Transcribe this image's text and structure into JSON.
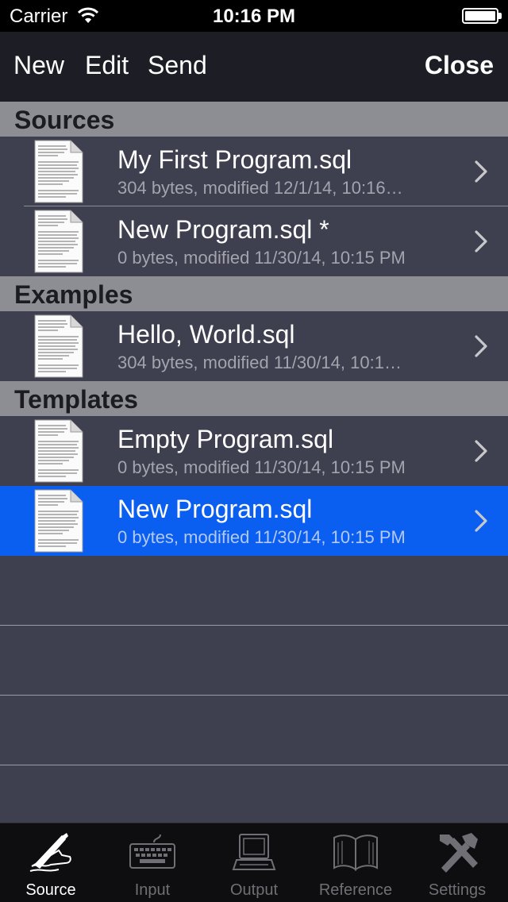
{
  "status_bar": {
    "carrier": "Carrier",
    "time": "10:16 PM"
  },
  "nav": {
    "new_label": "New",
    "edit_label": "Edit",
    "send_label": "Send",
    "close_label": "Close"
  },
  "sections": [
    {
      "header": "Sources",
      "rows": [
        {
          "title": "My First Program.sql",
          "subtitle": "304 bytes, modified 12/1/14, 10:16…"
        },
        {
          "title": "New Program.sql *",
          "subtitle": "0 bytes, modified 11/30/14, 10:15 PM"
        }
      ]
    },
    {
      "header": "Examples",
      "rows": [
        {
          "title": "Hello, World.sql",
          "subtitle": "304 bytes, modified 11/30/14, 10:1…"
        }
      ]
    },
    {
      "header": "Templates",
      "rows": [
        {
          "title": "Empty Program.sql",
          "subtitle": "0 bytes, modified 11/30/14, 10:15 PM"
        },
        {
          "title": "New Program.sql",
          "subtitle": "0 bytes, modified 11/30/14, 10:15 PM",
          "selected": true
        }
      ]
    }
  ],
  "tabs": [
    {
      "label": "Source",
      "icon": "pen-hand-icon",
      "active": true
    },
    {
      "label": "Input",
      "icon": "keyboard-icon"
    },
    {
      "label": "Output",
      "icon": "computer-icon"
    },
    {
      "label": "Reference",
      "icon": "book-icon"
    },
    {
      "label": "Settings",
      "icon": "tools-icon"
    }
  ],
  "colors": {
    "selected_row": "#0a5ff0",
    "section_header": "#8d8e93",
    "background": "#3e3f4f"
  }
}
